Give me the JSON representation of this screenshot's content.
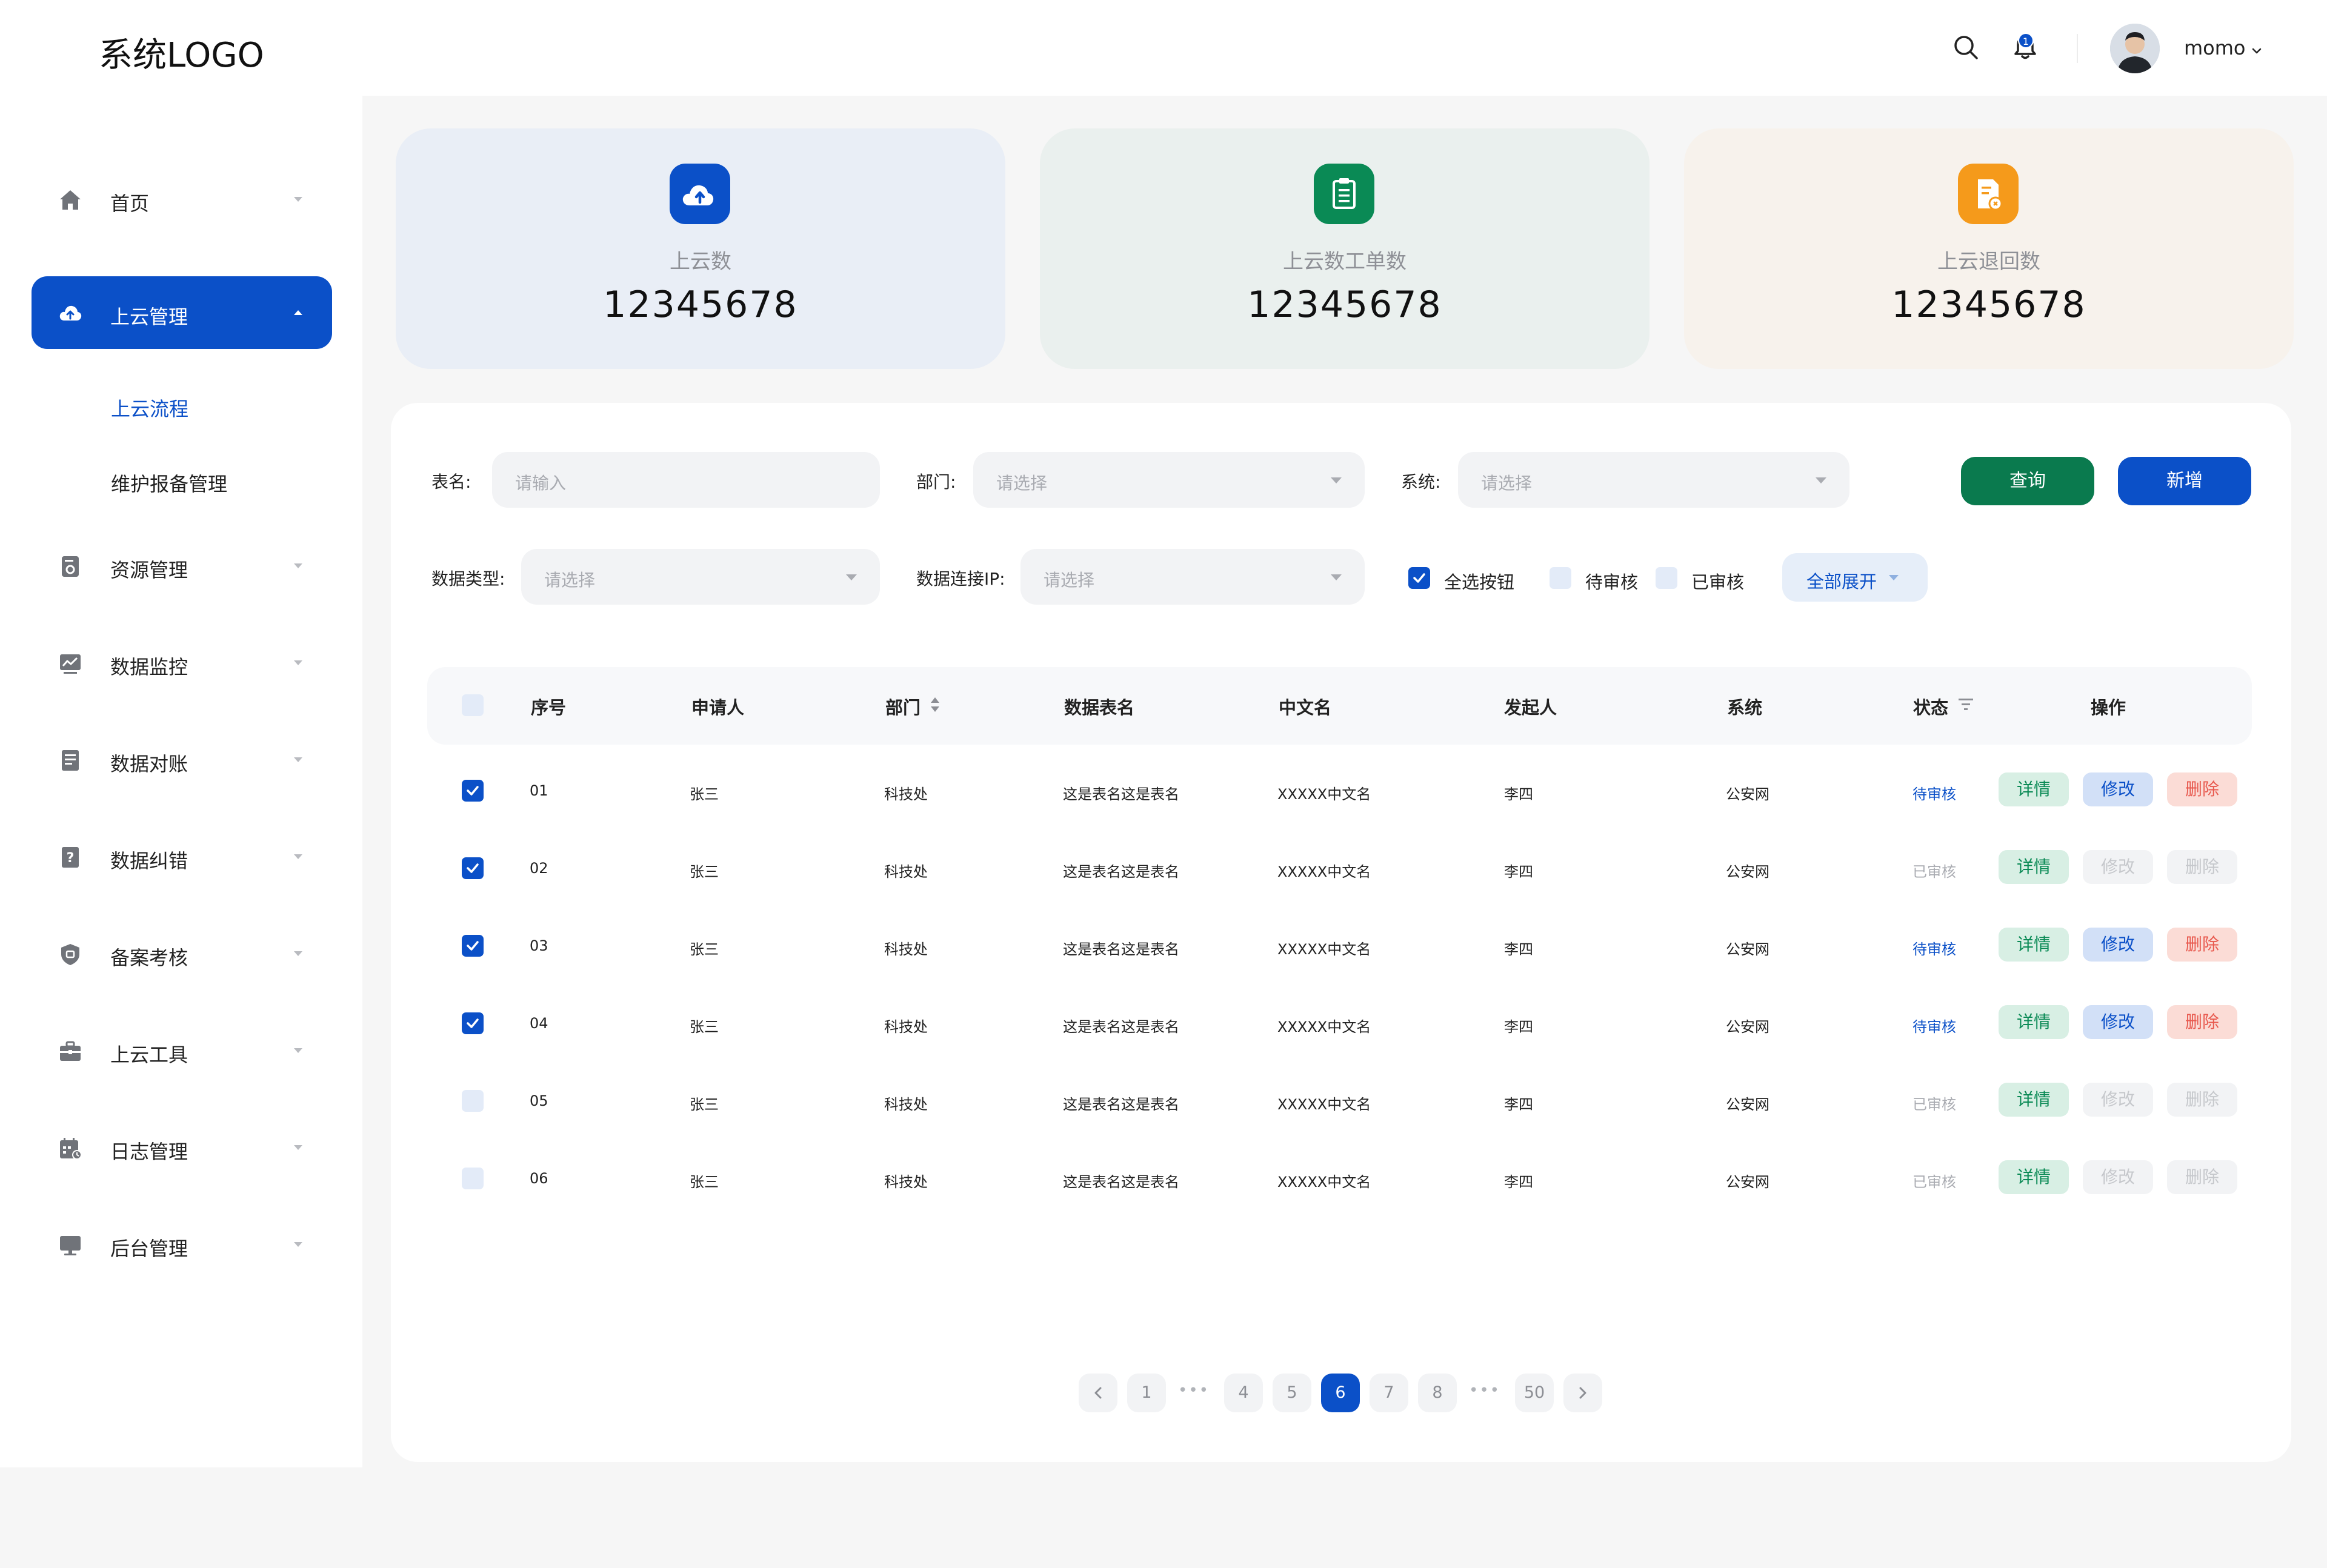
{
  "header": {
    "logo": "系统LOGO",
    "notification_count": "1",
    "username": "momo"
  },
  "sidebar": {
    "items": [
      {
        "label": "首页",
        "icon": "home-icon"
      },
      {
        "label": "上云管理",
        "icon": "cloud-upload-icon",
        "active": true
      },
      {
        "label": "资源管理",
        "icon": "resource-icon"
      },
      {
        "label": "数据监控",
        "icon": "monitor-chart-icon"
      },
      {
        "label": "数据对账",
        "icon": "ledger-icon"
      },
      {
        "label": "数据纠错",
        "icon": "help-document-icon"
      },
      {
        "label": "备案考核",
        "icon": "shield-icon"
      },
      {
        "label": "上云工具",
        "icon": "toolbox-icon"
      },
      {
        "label": "日志管理",
        "icon": "calendar-log-icon"
      },
      {
        "label": "后台管理",
        "icon": "desktop-icon"
      }
    ],
    "subitems": [
      {
        "label": "上云流程",
        "active": true
      },
      {
        "label": "维护报备管理"
      }
    ]
  },
  "stats": [
    {
      "label": "上云数",
      "value": "12345678",
      "icon": "cloud-upload-icon",
      "color": "#0b50c8",
      "bg": "#e9eef6"
    },
    {
      "label": "上云数工单数",
      "value": "12345678",
      "icon": "clipboard-icon",
      "color": "#0a8a55",
      "bg": "#eaf0ee"
    },
    {
      "label": "上云退回数",
      "value": "12345678",
      "icon": "document-return-icon",
      "color": "#f59a1b",
      "bg": "#f7f2ec"
    }
  ],
  "filters": {
    "table_name": {
      "label": "表名:",
      "placeholder": "请输入"
    },
    "department": {
      "label": "部门:",
      "placeholder": "请选择"
    },
    "system": {
      "label": "系统:",
      "placeholder": "请选择"
    },
    "data_type": {
      "label": "数据类型:",
      "placeholder": "请选择"
    },
    "data_ip": {
      "label": "数据连接IP:",
      "placeholder": "请选择"
    },
    "query_button": "查询",
    "add_button": "新增",
    "select_all": "全选按钮",
    "pending": "待审核",
    "approved": "已审核",
    "expand_all": "全部展开"
  },
  "table": {
    "columns": [
      "序号",
      "申请人",
      "部门",
      "数据表名",
      "中文名",
      "发起人",
      "系统",
      "状态",
      "操作"
    ],
    "actions": {
      "detail": "详情",
      "edit": "修改",
      "delete": "删除"
    },
    "rows": [
      {
        "checked": true,
        "no": "01",
        "applicant": "张三",
        "dept": "科技处",
        "table": "这是表名这是表名",
        "cn": "XXXXX中文名",
        "initiator": "李四",
        "system": "公安网",
        "status": "待审核",
        "pending": true
      },
      {
        "checked": true,
        "no": "02",
        "applicant": "张三",
        "dept": "科技处",
        "table": "这是表名这是表名",
        "cn": "XXXXX中文名",
        "initiator": "李四",
        "system": "公安网",
        "status": "已审核",
        "pending": false
      },
      {
        "checked": true,
        "no": "03",
        "applicant": "张三",
        "dept": "科技处",
        "table": "这是表名这是表名",
        "cn": "XXXXX中文名",
        "initiator": "李四",
        "system": "公安网",
        "status": "待审核",
        "pending": true
      },
      {
        "checked": true,
        "no": "04",
        "applicant": "张三",
        "dept": "科技处",
        "table": "这是表名这是表名",
        "cn": "XXXXX中文名",
        "initiator": "李四",
        "system": "公安网",
        "status": "待审核",
        "pending": true
      },
      {
        "checked": false,
        "no": "05",
        "applicant": "张三",
        "dept": "科技处",
        "table": "这是表名这是表名",
        "cn": "XXXXX中文名",
        "initiator": "李四",
        "system": "公安网",
        "status": "已审核",
        "pending": false
      },
      {
        "checked": false,
        "no": "06",
        "applicant": "张三",
        "dept": "科技处",
        "table": "这是表名这是表名",
        "cn": "XXXXX中文名",
        "initiator": "李四",
        "system": "公安网",
        "status": "已审核",
        "pending": false
      }
    ]
  },
  "pagination": {
    "pages": [
      "1",
      "4",
      "5",
      "6",
      "7",
      "8",
      "50"
    ],
    "current": "6",
    "ellipsis": "•••"
  },
  "colors": {
    "primary": "#0b50c8",
    "success": "#0a8a55",
    "danger": "#e85a4f"
  }
}
